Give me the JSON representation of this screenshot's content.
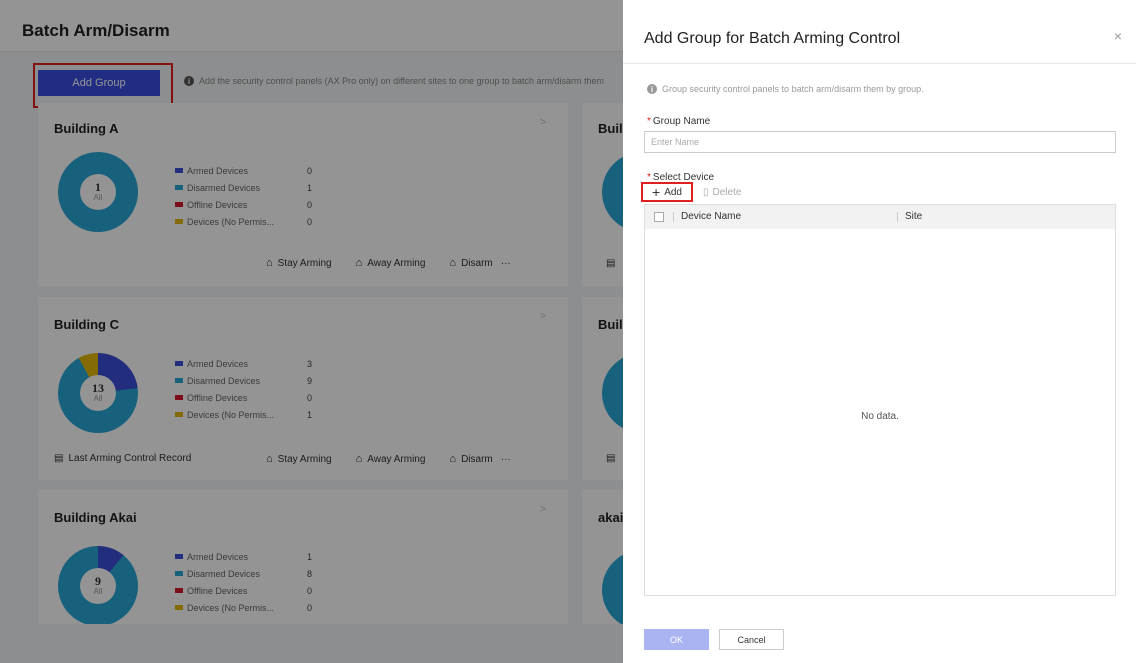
{
  "page": {
    "title": "Batch Arm/Disarm",
    "add_group_label": "Add Group",
    "hint": "Add the security control panels (AX Pro only) on different sites to one group to batch arm/disarm them"
  },
  "colors": {
    "armed": "#3b4fd8",
    "disarmed": "#29a7d6",
    "offline": "#d8172b",
    "no_permission": "#e5b80b",
    "primary": "#3a4fe0",
    "highlight": "#e02020"
  },
  "legend_labels": {
    "armed": "Armed Devices",
    "disarmed": "Disarmed Devices",
    "offline": "Offline Devices",
    "no_permission": "Devices (No Permis..."
  },
  "actions": {
    "stay": "Stay Arming",
    "away": "Away Arming",
    "disarm": "Disarm",
    "more": "···",
    "record": "Last Arming Control Record"
  },
  "cards": [
    {
      "name": "Building A",
      "total": "1",
      "total_label": "All",
      "armed": "0",
      "disarmed": "1",
      "offline": "0",
      "no_permission": "0"
    },
    {
      "name": "Building C",
      "total": "13",
      "total_label": "All",
      "armed": "3",
      "disarmed": "9",
      "offline": "0",
      "no_permission": "1"
    },
    {
      "name": "Building Akai",
      "total": "9",
      "total_label": "All",
      "armed": "1",
      "disarmed": "8",
      "offline": "0",
      "no_permission": "0"
    }
  ],
  "right_cards": [
    "Buil",
    "Buil",
    "akai"
  ],
  "drawer": {
    "title": "Add Group for Batch Arming Control",
    "close": "×",
    "hint": "Group security control panels to batch arm/disarm them by group.",
    "group_name_label": "Group Name",
    "group_name_placeholder": "Enter Name",
    "select_device_label": "Select Device",
    "add_label": "Add",
    "delete_label": "Delete",
    "columns": [
      "Device Name",
      "Site"
    ],
    "no_data": "No data.",
    "ok": "OK",
    "cancel": "Cancel"
  }
}
